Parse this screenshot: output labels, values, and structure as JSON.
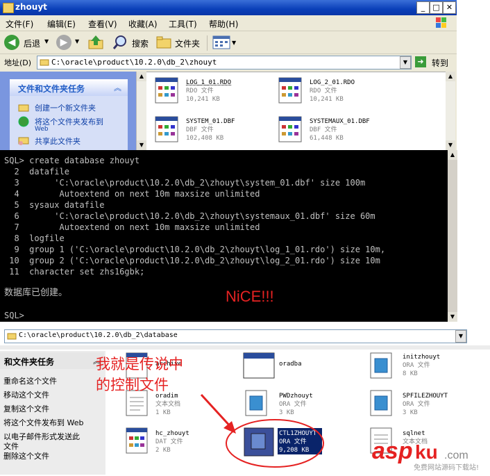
{
  "window1": {
    "title": "zhouyt",
    "menu": [
      "文件(F)",
      "编辑(E)",
      "查看(V)",
      "收藏(A)",
      "工具(T)",
      "帮助(H)"
    ],
    "toolbar": {
      "back": "后退",
      "search": "搜索",
      "folders": "文件夹"
    },
    "address_label": "地址(D)",
    "address": "C:\\oracle\\product\\10.2.0\\db_2\\zhouyt",
    "go": "转到",
    "tasks_title": "文件和文件夹任务",
    "tasks": [
      "创建一个新文件夹",
      "将这个文件夹发布到",
      "Web",
      "共享此文件夹"
    ],
    "files": [
      {
        "name": "LOG_1_01.RDO",
        "type": "RDO 文件",
        "size": "10,241 KB"
      },
      {
        "name": "LOG_2_01.RDO",
        "type": "RDO 文件",
        "size": "10,241 KB"
      },
      {
        "name": "SYSTEM_01.DBF",
        "type": "DBF 文件",
        "size": "102,408 KB"
      },
      {
        "name": "SYSTEMAUX_01.DBF",
        "type": "DBF 文件",
        "size": "61,448 KB"
      }
    ]
  },
  "console": {
    "lines": [
      "SQL> create database zhouyt",
      "  2  datafile",
      "  3       'C:\\oracle\\product\\10.2.0\\db_2\\zhouyt\\system_01.dbf' size 100m",
      "  4        Autoextend on next 10m maxsize unlimited",
      "  5  sysaux datafile",
      "  6       'C:\\oracle\\product\\10.2.0\\db_2\\zhouyt\\systemaux_01.dbf' size 60m",
      "  7        Autoextend on next 10m maxsize unlimited",
      "  8  logfile",
      "  9  group 1 ('C:\\oracle\\product\\10.2.0\\db_2\\zhouyt\\log_1_01.rdo') size 10m,",
      " 10  group 2 ('C:\\oracle\\product\\10.2.0\\db_2\\zhouyt\\log_2_01.rdo') size 10m",
      " 11  character set zhs16gbk;"
    ],
    "result": "数据库已创建。",
    "prompt": "SQL>",
    "nice": "NiCE!!!"
  },
  "window2": {
    "address": "C:\\oracle\\product\\10.2.0\\db_2\\database",
    "tasks_title": "和文件夹任务",
    "tasks": [
      "重命名这个文件",
      "移动这个文件",
      "复制这个文件",
      "将这个文件发布到 Web",
      "以电子邮件形式发送此",
      "文件",
      "删除这个文件"
    ],
    "annotation": [
      "我就是传说中",
      "的控制文件"
    ],
    "files": [
      {
        "name": "archive",
        "type": "",
        "size": ""
      },
      {
        "name": "oradba",
        "type": "",
        "size": ""
      },
      {
        "name": "initzhouyt",
        "type": "ORA 文件",
        "size": "8 KB"
      },
      {
        "name": "oradim",
        "type": "文本文档",
        "size": "1 KB"
      },
      {
        "name": "PWDzhouyt",
        "type": "ORA 文件",
        "size": "3 KB"
      },
      {
        "name": "SPFILEZHOUYT",
        "type": "ORA 文件",
        "size": "3 KB"
      },
      {
        "name": "hc_zhouyt",
        "type": "DAT 文件",
        "size": "2 KB"
      },
      {
        "name": "CTL1ZHOUYT",
        "type": "ORA 文件",
        "size": "9,208 KB"
      },
      {
        "name": "sqlnet",
        "type": "文本文档",
        "size": ""
      }
    ]
  },
  "watermark": {
    "brand": "aspku",
    "domain": ".com",
    "tagline": "免费网站源码下载站!"
  }
}
